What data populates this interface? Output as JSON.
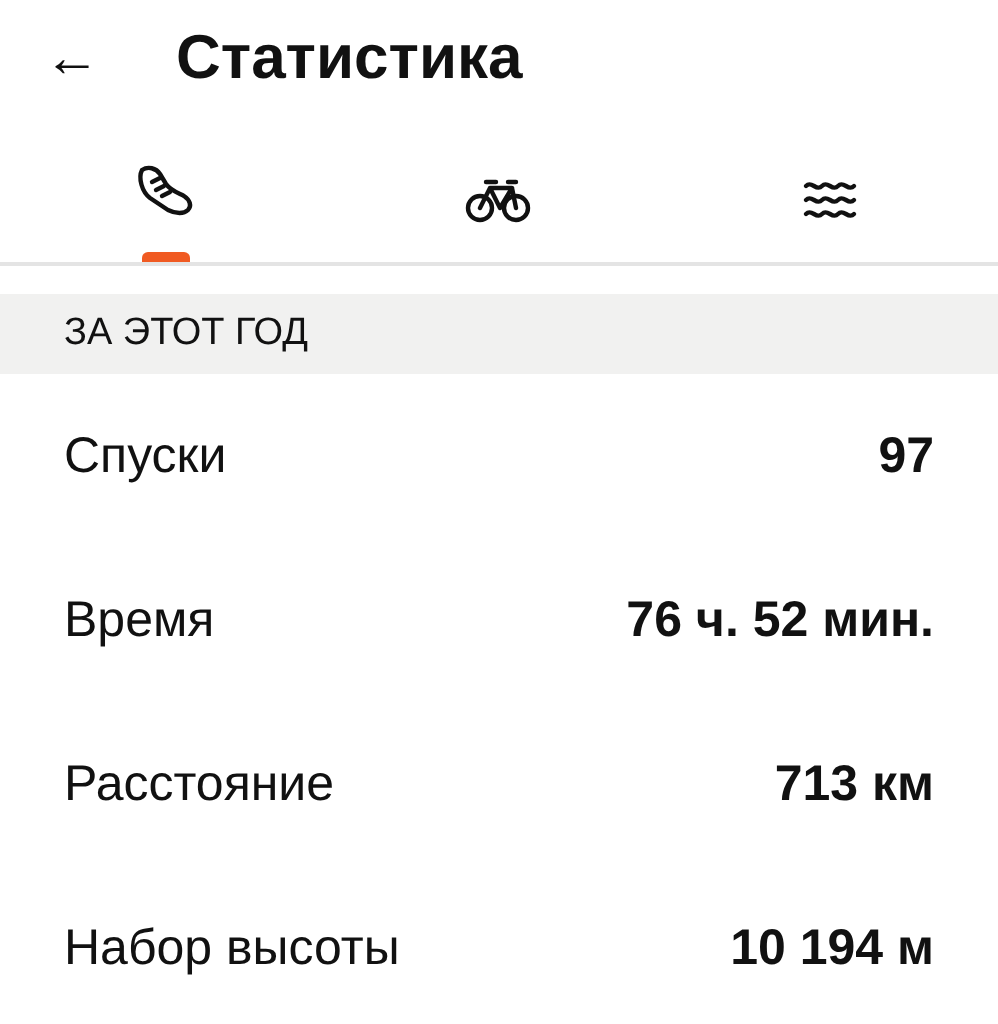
{
  "header": {
    "back": "←",
    "title": "Статистика"
  },
  "tabs": [
    {
      "kind": "run",
      "selected": true
    },
    {
      "kind": "bike",
      "selected": false
    },
    {
      "kind": "swim",
      "selected": false
    }
  ],
  "section": {
    "title": "ЗА ЭТОТ ГОД"
  },
  "stats": [
    {
      "label": "Спуски",
      "value": "97"
    },
    {
      "label": "Время",
      "value": "76 ч. 52 мин."
    },
    {
      "label": "Расстояние",
      "value": "713 км"
    },
    {
      "label": "Набор высоты",
      "value": "10 194 м"
    }
  ]
}
